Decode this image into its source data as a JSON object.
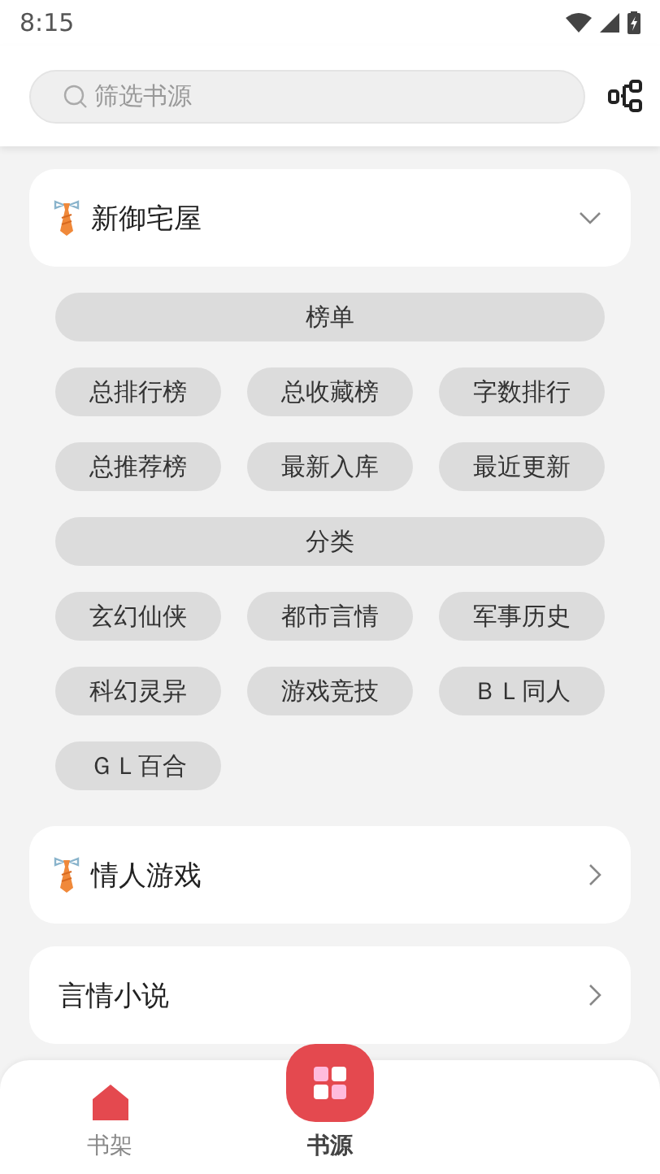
{
  "status_bar": {
    "time": "8:15"
  },
  "search": {
    "placeholder": "筛选书源"
  },
  "sources": [
    {
      "name": "新御宅屋",
      "kind": "icon",
      "expanded": true,
      "groups": [
        {
          "title": "榜单",
          "items": [
            "总排行榜",
            "总收藏榜",
            "字数排行",
            "总推荐榜",
            "最新入库",
            "最近更新"
          ]
        },
        {
          "title": "分类",
          "items": [
            "玄幻仙侠",
            "都市言情",
            "军事历史",
            "科幻灵异",
            "游戏竞技",
            "ＢＬ同人",
            "ＧＬ百合"
          ]
        }
      ]
    },
    {
      "name": "情人游戏",
      "kind": "icon",
      "expanded": false
    },
    {
      "name": "言情小说",
      "kind": "text",
      "expanded": false
    }
  ],
  "nav": [
    {
      "label": "书架",
      "selected": false
    },
    {
      "label": "书源",
      "selected": true
    }
  ]
}
